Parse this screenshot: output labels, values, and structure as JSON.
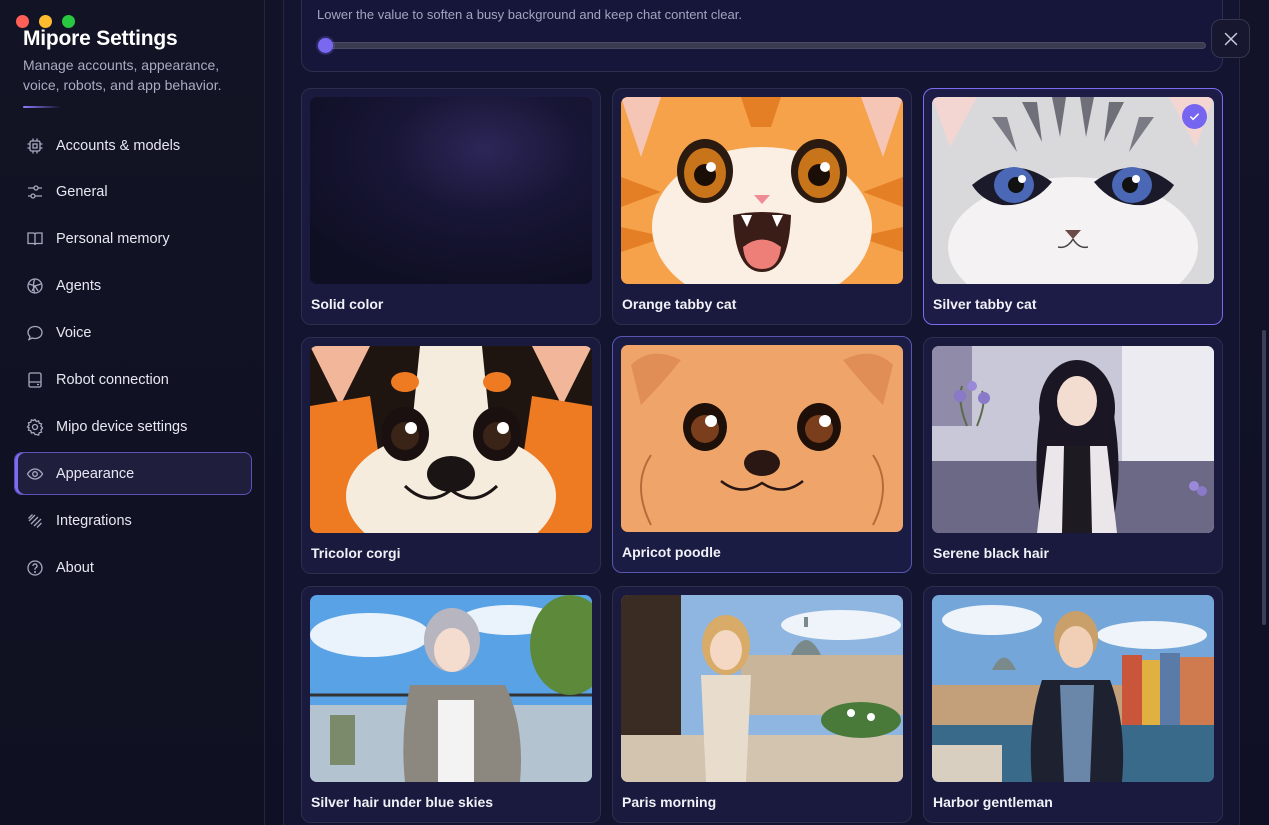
{
  "window": {
    "controls": [
      "close",
      "minimize",
      "maximize"
    ]
  },
  "sidebar": {
    "title": "Mipore Settings",
    "subtitle": "Manage accounts, appearance, voice, robots, and app behavior.",
    "items": [
      {
        "label": "Accounts & models",
        "icon": "chip-icon"
      },
      {
        "label": "General",
        "icon": "sliders-icon"
      },
      {
        "label": "Personal memory",
        "icon": "book-icon"
      },
      {
        "label": "Agents",
        "icon": "agent-icon"
      },
      {
        "label": "Voice",
        "icon": "chat-bubble-icon"
      },
      {
        "label": "Robot connection",
        "icon": "device-icon"
      },
      {
        "label": "Mipo device settings",
        "icon": "gear-icon"
      },
      {
        "label": "Appearance",
        "icon": "eye-icon",
        "active": true
      },
      {
        "label": "Integrations",
        "icon": "integration-icon"
      },
      {
        "label": "About",
        "icon": "help-icon"
      }
    ]
  },
  "appearance": {
    "opacity_hint": "Lower the value to soften a busy background and keep chat content clear.",
    "opacity_value_fraction": 0.0,
    "selected": "Silver tabby cat",
    "accent_color": "#7565f0",
    "backgrounds": [
      {
        "label": "Solid color"
      },
      {
        "label": "Orange tabby cat"
      },
      {
        "label": "Silver tabby cat",
        "selected": true
      },
      {
        "label": "Tricolor corgi"
      },
      {
        "label": "Apricot poodle",
        "hovered": true
      },
      {
        "label": "Serene black hair"
      },
      {
        "label": "Silver hair under blue skies"
      },
      {
        "label": "Paris morning"
      },
      {
        "label": "Harbor gentleman"
      }
    ]
  }
}
